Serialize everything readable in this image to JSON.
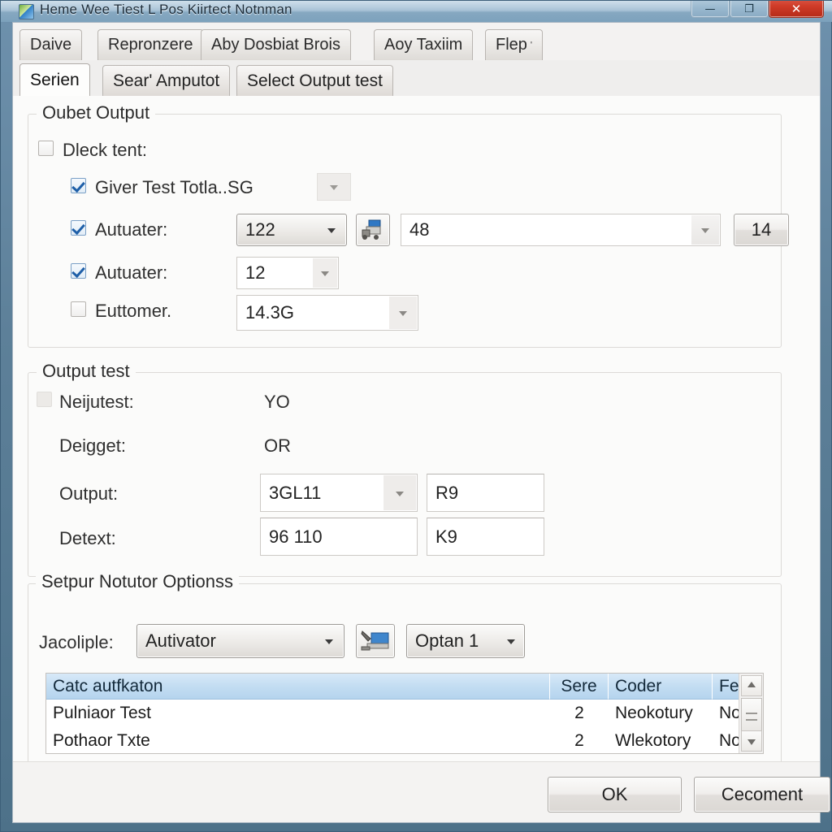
{
  "window": {
    "title": "Heme Wee Tiest L Pos Kiirtect Notnman",
    "icon": "app-icon",
    "controls": {
      "minimize": "—",
      "maximize": "❐",
      "close": "✕"
    },
    "accent_color": "#4d7189",
    "close_color": "#cf3b28"
  },
  "outer_tabs": [
    {
      "label": "Daive",
      "active": false
    },
    {
      "label": "Repronzere",
      "active": false
    },
    {
      "label": "Aby Dosbiat Brois",
      "active": false
    },
    {
      "label": "Aoy Taxiim",
      "active": false
    },
    {
      "label": "Flep",
      "superscript": "ʹ",
      "active": false
    }
  ],
  "inner_tabs": [
    {
      "label": "Serien",
      "active": true
    },
    {
      "label": "Searʹ Amputot",
      "active": false
    },
    {
      "label": "Select Output test",
      "active": false
    }
  ],
  "group_outbet": {
    "legend": "Oubet Output",
    "check_parent": {
      "label": "Dleck tent:",
      "checked": false
    },
    "rows": [
      {
        "label": "Giver Test Totla..SG",
        "checked": true,
        "dropdown": "chevron-down-icon"
      },
      {
        "label": "Autuater:",
        "checked": true,
        "combo_value": "122",
        "icon_button": "printer-icon",
        "wide_value": "48",
        "small_button": "14"
      },
      {
        "label": "Autuater:",
        "checked": true,
        "combo_value": "12"
      },
      {
        "label": "Euttomer.",
        "checked": false,
        "combo_value": "14.3G"
      }
    ]
  },
  "group_output_test": {
    "legend": "Output test",
    "rows": [
      {
        "label": "Neijutest:",
        "has_checkbox": true,
        "value": "YO"
      },
      {
        "label": "Deigget:",
        "has_checkbox": false,
        "value": "OR"
      },
      {
        "label": "Output:",
        "has_checkbox": false,
        "combo_value": "3GL11",
        "text_value": "R9"
      },
      {
        "label": "Detext:",
        "has_checkbox": false,
        "text_left": "96 110",
        "text_value": "K9"
      }
    ]
  },
  "group_setpur": {
    "legend": "Setpur Notutor Optionss",
    "field_label": "Jacoliple:",
    "combo_value": "Autivator",
    "icon_button": "scanner-icon",
    "option_combo_value": "Optan 1",
    "list": {
      "columns": [
        "Catc autfkaton",
        "Sere",
        "Coder",
        "Fele"
      ],
      "rows": [
        {
          "cells": [
            "Pulniaor Test",
            "2",
            "Neokotury",
            "Not"
          ]
        },
        {
          "cells": [
            "Pothaor Txte",
            "2",
            "Wlekotory",
            "Not"
          ]
        }
      ],
      "scrollbar": {
        "up": "scroll-up-icon",
        "down": "scroll-down-icon",
        "thumb": "scroll-thumb"
      }
    }
  },
  "footer": {
    "ok_label": "OK",
    "cancel_label": "Cecoment"
  }
}
